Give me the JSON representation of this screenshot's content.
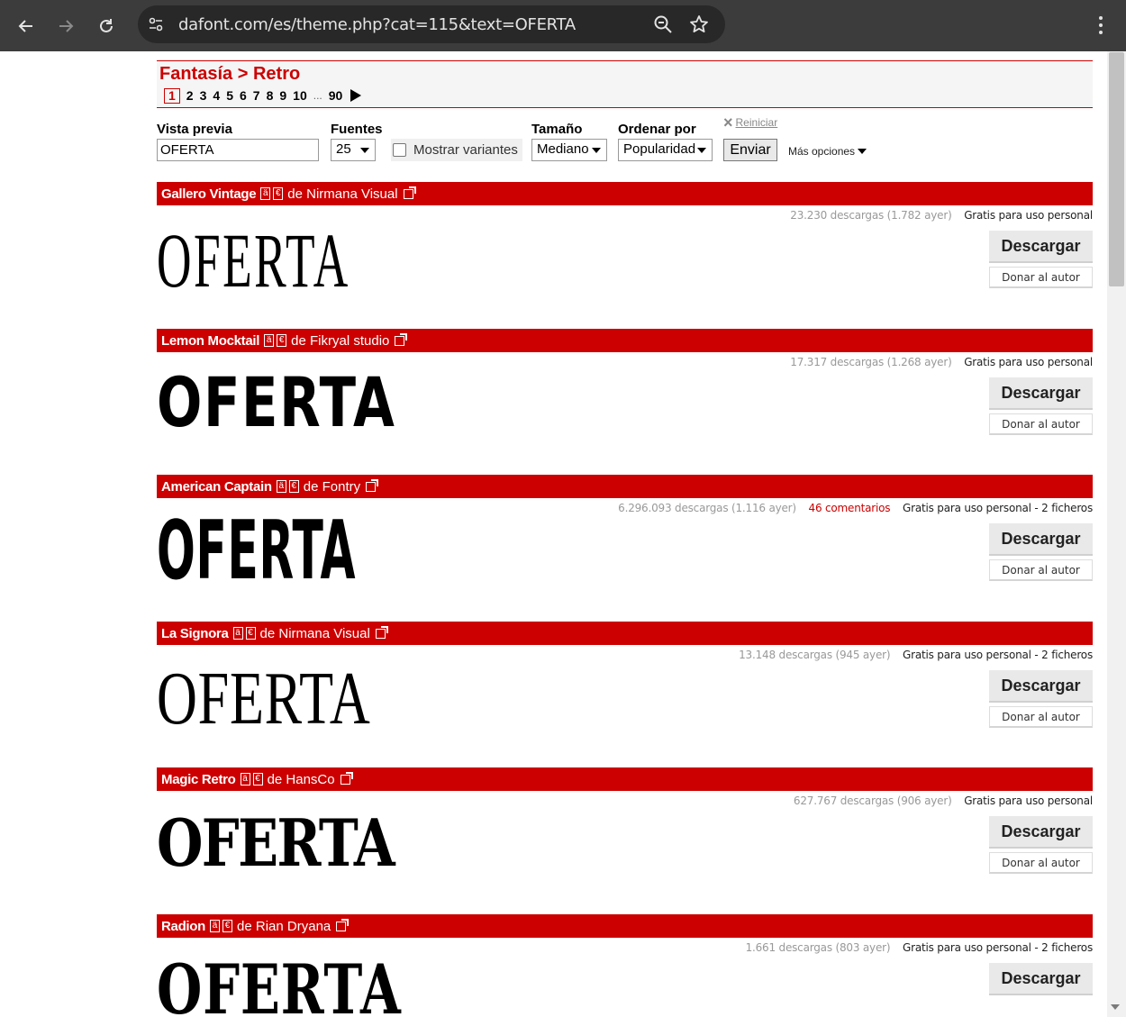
{
  "browser": {
    "url": "dafont.com/es/theme.php?cat=115&text=OFERTA"
  },
  "breadcrumb": {
    "category": "Fantasía",
    "separator": ">",
    "subcategory": "Retro"
  },
  "pagination": {
    "current": "1",
    "pages": [
      "2",
      "3",
      "4",
      "5",
      "6",
      "7",
      "8",
      "9",
      "10"
    ],
    "ellipsis": "...",
    "last": "90"
  },
  "filters": {
    "preview_label": "Vista previa",
    "preview_value": "OFERTA",
    "fonts_label": "Fuentes",
    "fonts_value": "25",
    "variants_label": "Mostrar variantes",
    "size_label": "Tamaño",
    "size_value": "Mediano",
    "order_label": "Ordenar por",
    "order_value": "Popularidad",
    "submit_label": "Enviar",
    "reset_label": "Reiniciar",
    "more_label": "Más opciones"
  },
  "badges": {
    "a": "ä",
    "e": "€"
  },
  "entry_buttons": {
    "download": "Descargar",
    "donate": "Donar al autor"
  },
  "fonts": [
    {
      "name": "Gallero Vintage",
      "author": "de Nirmana Visual",
      "downloads": "23.230 descargas (1.782 ayer)",
      "comments": "",
      "license": "Gratis para uso personal",
      "preview": "OFERTA"
    },
    {
      "name": "Lemon Mocktail",
      "author": "de Fikryal studio",
      "downloads": "17.317 descargas (1.268 ayer)",
      "comments": "",
      "license": "Gratis para uso personal",
      "preview": "OFERTA"
    },
    {
      "name": "American Captain",
      "author": "de Fontry",
      "downloads": "6.296.093 descargas (1.116 ayer)",
      "comments": "46 comentarios",
      "license": "Gratis para uso personal - 2 ficheros",
      "preview": "OFERTA"
    },
    {
      "name": "La Signora",
      "author": "de Nirmana Visual",
      "downloads": "13.148 descargas (945 ayer)",
      "comments": "",
      "license": "Gratis para uso personal - 2 ficheros",
      "preview": "OFERTA"
    },
    {
      "name": "Magic Retro",
      "author": "de HansCo",
      "downloads": "627.767 descargas (906 ayer)",
      "comments": "",
      "license": "Gratis para uso personal",
      "preview": "OFERTA"
    },
    {
      "name": "Radion",
      "author": "de Rian Dryana",
      "downloads": "1.661 descargas (803 ayer)",
      "comments": "",
      "license": "Gratis para uso personal - 2 ficheros",
      "preview": "OFERTA"
    }
  ]
}
